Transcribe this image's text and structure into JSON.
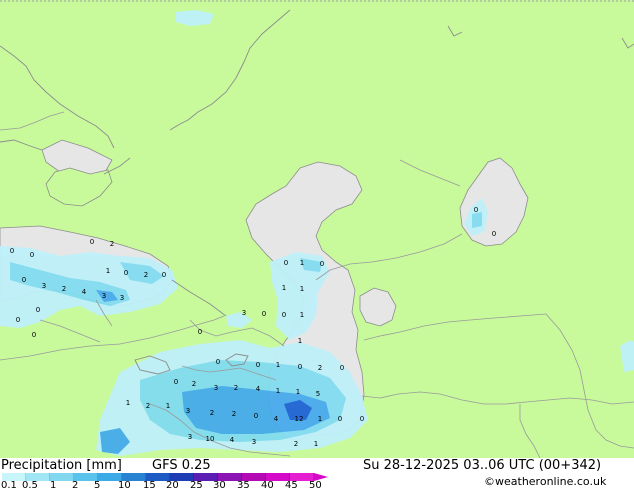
{
  "title": "Precipitation [mm]",
  "model": "GFS 0.25",
  "valid_time": "Su 28-12-2025 03..06 UTC (00+342)",
  "credit": "©weatheronline.co.uk",
  "colors": {
    "land": "#c8fa9c",
    "sea": "#e6e6e6",
    "border": "#9a9a9a",
    "coast": "#8c8c8c",
    "precip_light": "#bef0fa",
    "precip_mid": "#82dcf0",
    "precip_heavy": "#46aaeb",
    "precip_strong": "#1e64d2"
  },
  "legend": {
    "ticks": [
      "0.1",
      "0.5",
      "1",
      "2",
      "5",
      "10",
      "15",
      "20",
      "25",
      "30",
      "35",
      "40",
      "45",
      "50"
    ],
    "colors": [
      "#c8f5fa",
      "#a0e6f5",
      "#82d7f0",
      "#5ac3eb",
      "#3caae6",
      "#2882d2",
      "#1e5ac3",
      "#1e3cb4",
      "#5a1eb4",
      "#8c14b4",
      "#b40ab4",
      "#d40ac8",
      "#e61ed2"
    ]
  },
  "labels": [
    "0",
    "2",
    "1",
    "0",
    "2",
    "0",
    "3",
    "2",
    "4",
    "3",
    "3",
    "0",
    "0",
    "0",
    "0",
    "0",
    "0",
    "1",
    "1",
    "0",
    "1",
    "0",
    "1",
    "0",
    "0",
    "3",
    "0",
    "1",
    "0",
    "0",
    "1",
    "0",
    "2",
    "0",
    "0",
    "2",
    "2",
    "3",
    "1",
    "2",
    "1",
    "3",
    "2",
    "2",
    "4",
    "12",
    "1",
    "1",
    "5",
    "0",
    "1",
    "0",
    "3",
    "10",
    "4",
    "3",
    "4",
    "2",
    "1",
    "0",
    "0",
    "0"
  ]
}
